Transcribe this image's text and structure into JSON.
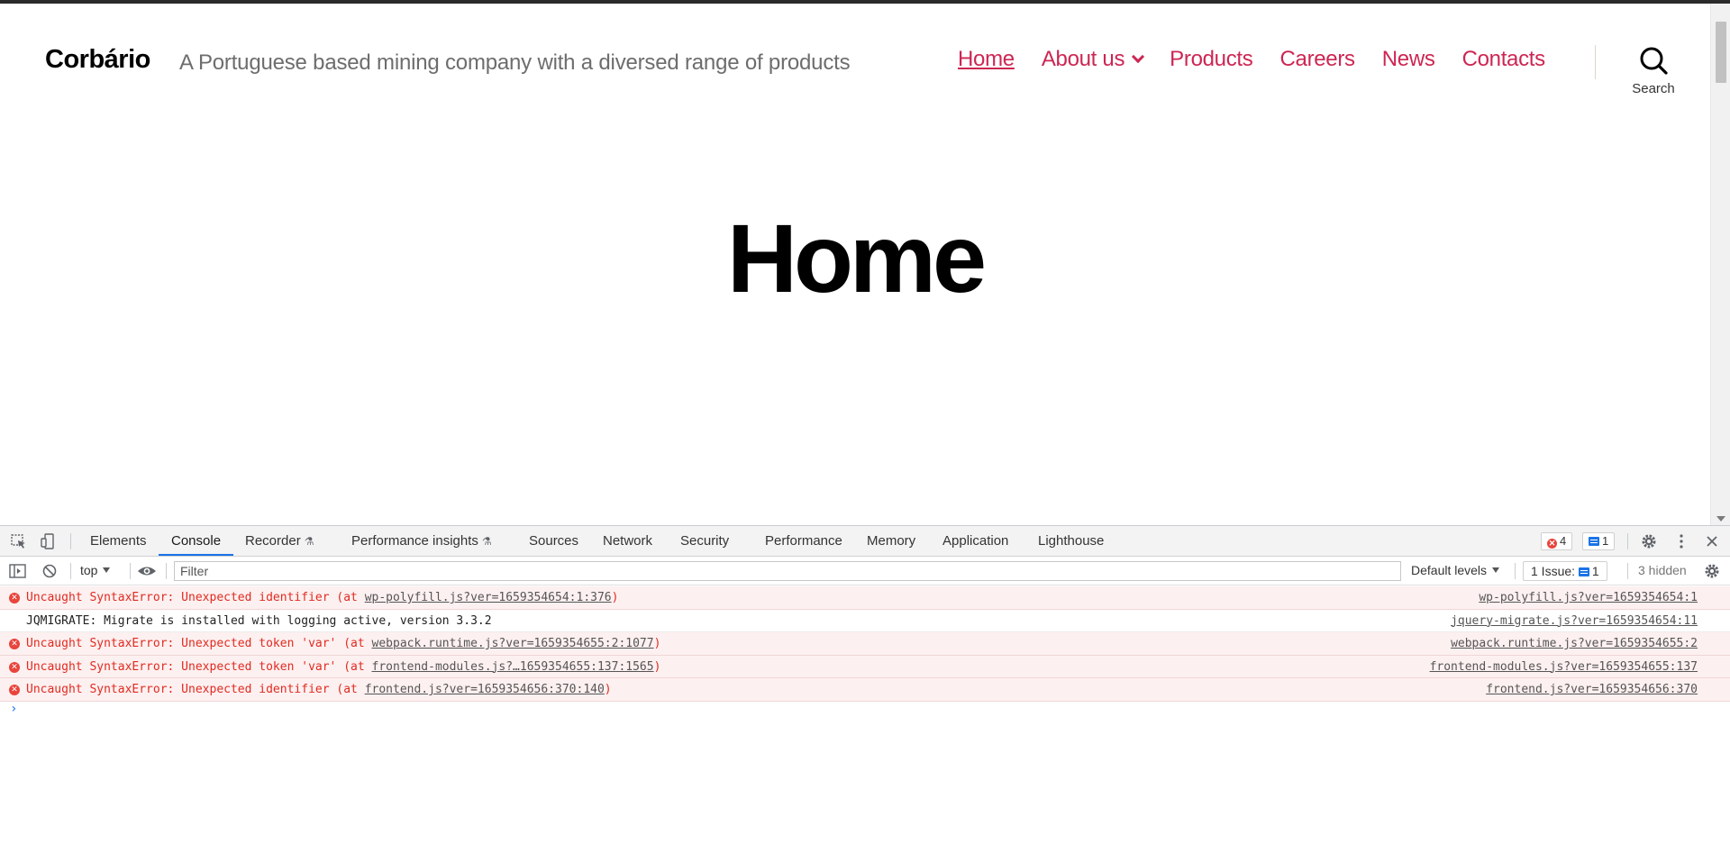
{
  "site": {
    "title": "Corbário",
    "description": "A Portuguese based mining company with a diversed range of products",
    "nav": [
      {
        "label": "Home",
        "current": true,
        "has_submenu": false
      },
      {
        "label": "About us",
        "current": false,
        "has_submenu": true
      },
      {
        "label": "Products",
        "current": false,
        "has_submenu": false
      },
      {
        "label": "Careers",
        "current": false,
        "has_submenu": false
      },
      {
        "label": "News",
        "current": false,
        "has_submenu": false
      },
      {
        "label": "Contacts",
        "current": false,
        "has_submenu": false
      }
    ],
    "search_label": "Search",
    "page_heading": "Home",
    "accent_color": "#cd2653"
  },
  "devtools": {
    "tabs": [
      {
        "label": "Elements",
        "experimental": false,
        "active": false
      },
      {
        "label": "Console",
        "experimental": false,
        "active": true
      },
      {
        "label": "Recorder",
        "experimental": true,
        "active": false
      },
      {
        "label": "Performance insights",
        "experimental": true,
        "active": false
      },
      {
        "label": "Sources",
        "experimental": false,
        "active": false
      },
      {
        "label": "Network",
        "experimental": false,
        "active": false
      },
      {
        "label": "Security",
        "experimental": false,
        "active": false
      },
      {
        "label": "Performance",
        "experimental": false,
        "active": false
      },
      {
        "label": "Memory",
        "experimental": false,
        "active": false
      },
      {
        "label": "Application",
        "experimental": false,
        "active": false
      },
      {
        "label": "Lighthouse",
        "experimental": false,
        "active": false
      }
    ],
    "error_count": "4",
    "message_count": "1",
    "toolbar": {
      "context": "top",
      "filter_placeholder": "Filter",
      "levels": "Default levels",
      "issues_label": "1 Issue:",
      "issues_count": "1",
      "hidden": "3 hidden"
    },
    "console": [
      {
        "level": "error",
        "prefix": "Uncaught SyntaxError: Unexpected identifier (at ",
        "link": "wp-polyfill.js?ver=1659354654:1:376",
        "suffix": ")",
        "source": "wp-polyfill.js?ver=1659354654:1"
      },
      {
        "level": "info",
        "prefix": "JQMIGRATE: Migrate is installed with logging active, version 3.3.2",
        "link": "",
        "suffix": "",
        "source": "jquery-migrate.js?ver=1659354654:11"
      },
      {
        "level": "error",
        "prefix": "Uncaught SyntaxError: Unexpected token 'var' (at ",
        "link": "webpack.runtime.js?ver=1659354655:2:1077",
        "suffix": ")",
        "source": "webpack.runtime.js?ver=1659354655:2"
      },
      {
        "level": "error",
        "prefix": "Uncaught SyntaxError: Unexpected token 'var' (at ",
        "link": "frontend-modules.js?…1659354655:137:1565",
        "suffix": ")",
        "source": "frontend-modules.js?ver=1659354655:137"
      },
      {
        "level": "error",
        "prefix": "Uncaught SyntaxError: Unexpected identifier (at ",
        "link": "frontend.js?ver=1659354656:370:140",
        "suffix": ")",
        "source": "frontend.js?ver=1659354656:370"
      }
    ],
    "prompt": "›"
  }
}
